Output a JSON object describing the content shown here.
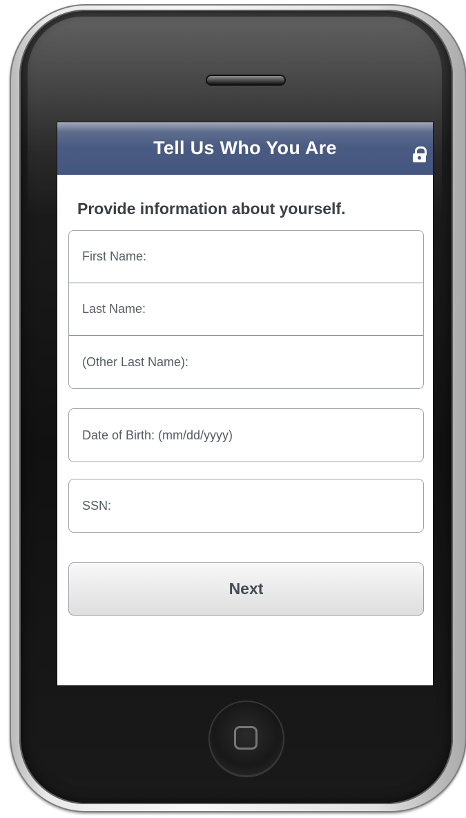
{
  "header": {
    "title": "Tell Us Who You Are",
    "icon": "lock-icon"
  },
  "main": {
    "intro": "Provide information about yourself.",
    "name_fields": [
      {
        "placeholder": "First Name:",
        "value": ""
      },
      {
        "placeholder": "Last Name:",
        "value": ""
      },
      {
        "placeholder": "(Other Last Name):",
        "value": ""
      }
    ],
    "dob_field": {
      "placeholder": "Date of Birth: (mm/dd/yyyy)",
      "value": ""
    },
    "ssn_field": {
      "placeholder": "SSN:",
      "value": ""
    },
    "next_button": "Next"
  },
  "device": {
    "speaker_icon": "speaker-icon",
    "home_icon": "home-square-icon"
  },
  "colors": {
    "header": "#44567f",
    "text": "#3b3f46",
    "button": "#ececec"
  }
}
